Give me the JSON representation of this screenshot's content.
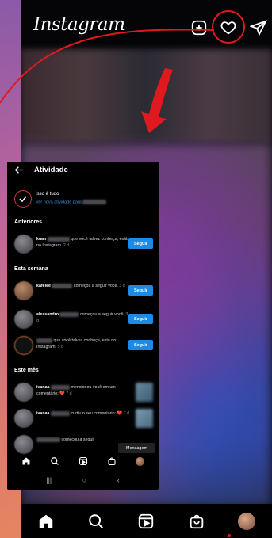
{
  "header": {
    "logo": "Instagram",
    "icons": [
      "plus-square-icon",
      "heart-icon",
      "send-icon"
    ]
  },
  "colors": {
    "highlight": "#e0191f",
    "follow": "#1d8ae6",
    "link": "#3a8bd8"
  },
  "activity": {
    "title": "Atividade",
    "done_title": "Isso é tudo",
    "done_subtitle": "Ver nova atividade para",
    "sections": {
      "previous": "Anteriores",
      "this_week": "Esta semana",
      "this_month": "Este mês"
    },
    "previous_items": [
      {
        "user": "kuan",
        "text": "que você talvez conheça, está no Instagram.",
        "time": "2 d",
        "button": "Seguir"
      }
    ],
    "week_items": [
      {
        "user": "kafelee",
        "text": "começou a seguir você.",
        "time": "3 d",
        "button": "Seguir"
      },
      {
        "user": "alessandro",
        "text": "começou a seguir você.",
        "time": "3 d",
        "button": "Seguir"
      },
      {
        "user": "",
        "text": "que você talvez conheça, está no Instagram.",
        "time": "5 d",
        "button": "Seguir"
      }
    ],
    "month_items": [
      {
        "user": "ivanaa",
        "text": "mencionou você em um comentário:",
        "emoji": "❤️",
        "time": "7 d"
      },
      {
        "user": "ivanaa",
        "text": "curtiu o seu comentário:",
        "emoji": "❤️",
        "time": "7 d"
      },
      {
        "user": "",
        "text": "começou a seguir",
        "time": ""
      }
    ],
    "message_button": "Mensagem"
  },
  "system_nav": {
    "recents": "|||",
    "home": "○",
    "back": "‹"
  }
}
